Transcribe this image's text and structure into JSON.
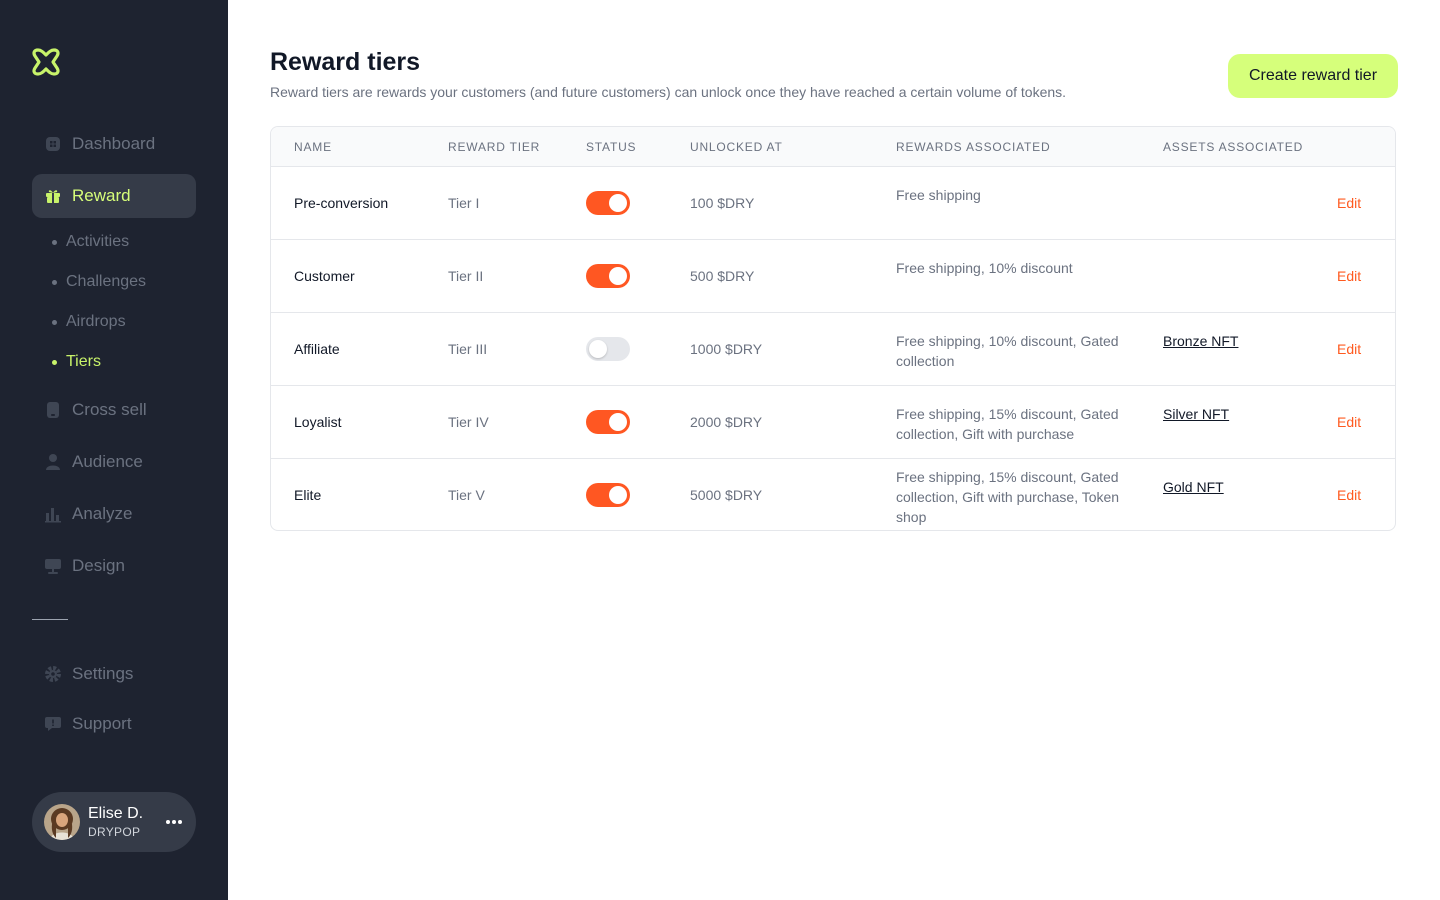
{
  "sidebar": {
    "logo": "drypop-logo",
    "items": [
      {
        "label": "Dashboard",
        "icon": "grid-icon"
      },
      {
        "label": "Reward",
        "icon": "gift-icon",
        "active": true
      },
      {
        "label": "Cross sell",
        "icon": "phone-icon"
      },
      {
        "label": "Audience",
        "icon": "user-icon"
      },
      {
        "label": "Analyze",
        "icon": "bar-chart-icon"
      },
      {
        "label": "Design",
        "icon": "display-icon"
      },
      {
        "label": "Settings",
        "icon": "gear-icon"
      },
      {
        "label": "Support",
        "icon": "chat-icon"
      }
    ],
    "sub_items": [
      {
        "label": "Activities"
      },
      {
        "label": "Challenges"
      },
      {
        "label": "Airdrops"
      },
      {
        "label": "Tiers",
        "active": true
      }
    ],
    "user": {
      "name": "Elise D.",
      "org": "DRYPOP"
    }
  },
  "header": {
    "title": "Reward tiers",
    "subtitle": "Reward tiers are rewards your customers (and future customers) can unlock once they have reached a certain volume of tokens.",
    "create_label": "Create reward tier"
  },
  "table": {
    "columns": [
      "NAME",
      "REWARD TIER",
      "STATUS",
      "UNLOCKED AT",
      "REWARDS ASSOCIATED",
      "ASSETS ASSOCIATED"
    ],
    "edit_label": "Edit",
    "rows": [
      {
        "name": "Pre-conversion",
        "tier": "Tier I",
        "status": true,
        "unlocked": "100 $DRY",
        "rewards": "Free shipping",
        "asset": ""
      },
      {
        "name": "Customer",
        "tier": "Tier II",
        "status": true,
        "unlocked": "500 $DRY",
        "rewards": "Free shipping, 10% discount",
        "asset": ""
      },
      {
        "name": "Affiliate",
        "tier": "Tier III",
        "status": false,
        "unlocked": "1000 $DRY",
        "rewards": "Free shipping, 10% discount, Gated collection",
        "asset": "Bronze NFT"
      },
      {
        "name": "Loyalist",
        "tier": "Tier IV",
        "status": true,
        "unlocked": "2000 $DRY",
        "rewards": "Free shipping, 15% discount, Gated collection, Gift with purchase",
        "asset": "Silver NFT"
      },
      {
        "name": "Elite",
        "tier": "Tier V",
        "status": true,
        "unlocked": "5000 $DRY",
        "rewards": "Free shipping, 15% discount, Gated collection, Gift with purchase, Token shop",
        "asset": "Gold NFT"
      }
    ]
  },
  "colors": {
    "sidebar_bg": "#1e2330",
    "accent_lime": "#d6ff7b",
    "toggle_on": "#ff5722",
    "edit_link": "#ff5a1f"
  }
}
